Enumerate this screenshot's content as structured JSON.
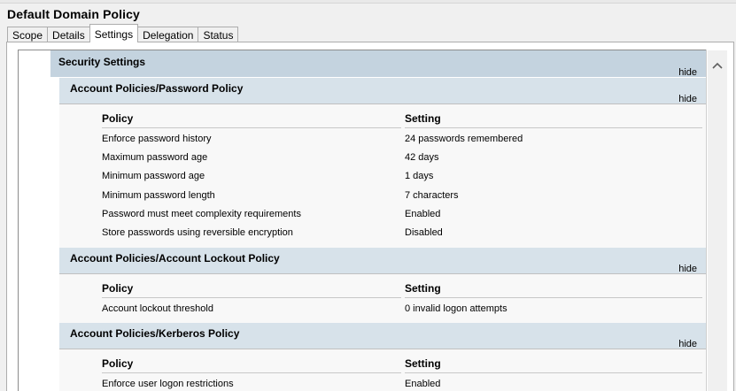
{
  "window": {
    "title": "Default Domain Policy"
  },
  "tabs": [
    {
      "label": "Scope",
      "active": false
    },
    {
      "label": "Details",
      "active": false
    },
    {
      "label": "Settings",
      "active": true
    },
    {
      "label": "Delegation",
      "active": false
    },
    {
      "label": "Status",
      "active": false
    }
  ],
  "report": {
    "section": {
      "title": "Security Settings",
      "hide_label": "hide"
    },
    "groups": [
      {
        "title": "Account Policies/Password Policy",
        "hide_label": "hide",
        "headers": {
          "policy": "Policy",
          "setting": "Setting"
        },
        "rows": [
          {
            "policy": "Enforce password history",
            "setting": "24 passwords remembered"
          },
          {
            "policy": "Maximum password age",
            "setting": "42 days"
          },
          {
            "policy": "Minimum password age",
            "setting": "1 days"
          },
          {
            "policy": "Minimum password length",
            "setting": "7 characters"
          },
          {
            "policy": "Password must meet complexity requirements",
            "setting": "Enabled"
          },
          {
            "policy": "Store passwords using reversible encryption",
            "setting": "Disabled"
          }
        ]
      },
      {
        "title": "Account Policies/Account Lockout Policy",
        "hide_label": "hide",
        "headers": {
          "policy": "Policy",
          "setting": "Setting"
        },
        "rows": [
          {
            "policy": "Account lockout threshold",
            "setting": "0 invalid logon attempts"
          }
        ]
      },
      {
        "title": "Account Policies/Kerberos Policy",
        "hide_label": "hide",
        "headers": {
          "policy": "Policy",
          "setting": "Setting"
        },
        "rows": [
          {
            "policy": "Enforce user logon restrictions",
            "setting": "Enabled"
          }
        ]
      }
    ]
  },
  "scrollbar": {
    "up_icon": "chevron-up-icon"
  }
}
